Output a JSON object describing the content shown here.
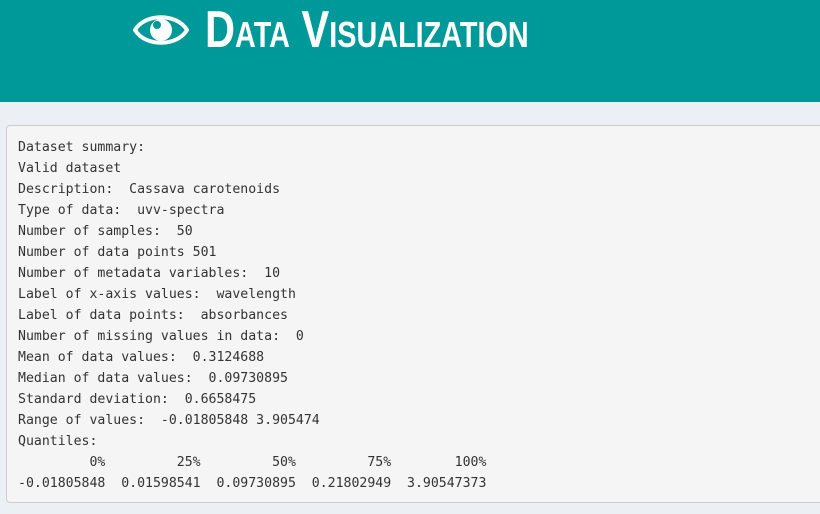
{
  "header": {
    "title": "Data Visualization",
    "icon": "eye-icon",
    "background": "#009999"
  },
  "summary": {
    "lines": [
      "Dataset summary:",
      "Valid dataset",
      "Description:  Cassava carotenoids",
      "Type of data:  uvv-spectra",
      "Number of samples:  50",
      "Number of data points 501",
      "Number of metadata variables:  10",
      "Label of x-axis values:  wavelength",
      "Label of data points:  absorbances",
      "Number of missing values in data:  0",
      "Mean of data values:  0.3124688",
      "Median of data values:  0.09730895",
      "Standard deviation:  0.6658475",
      "Range of values:  -0.01805848 3.905474",
      "Quantiles:",
      "         0%         25%         50%         75%        100% ",
      "-0.01805848  0.01598541  0.09730895  0.21802949  3.90547373 "
    ]
  }
}
